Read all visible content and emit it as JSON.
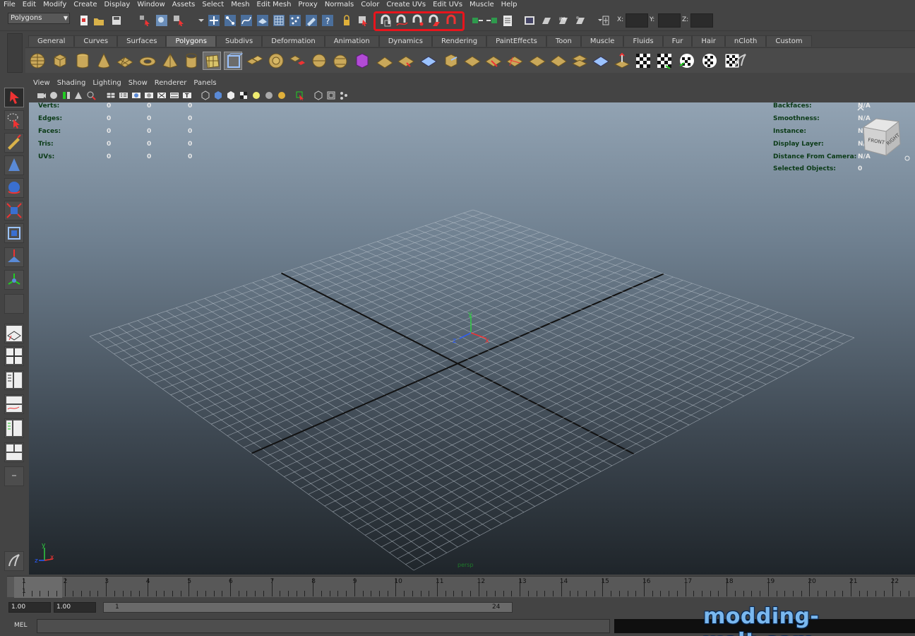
{
  "menubar": [
    "File",
    "Edit",
    "Modify",
    "Create",
    "Display",
    "Window",
    "Assets",
    "Select",
    "Mesh",
    "Edit Mesh",
    "Proxy",
    "Normals",
    "Color",
    "Create UVs",
    "Edit UVs",
    "Muscle",
    "Help"
  ],
  "statusline": {
    "mode": "Polygons",
    "x_label": "X:",
    "y_label": "Y:",
    "z_label": "Z:",
    "highlight_color": "#e8141c"
  },
  "shelf": {
    "tabs": [
      "General",
      "Curves",
      "Surfaces",
      "Polygons",
      "Subdivs",
      "Deformation",
      "Animation",
      "Dynamics",
      "Rendering",
      "PaintEffects",
      "Toon",
      "Muscle",
      "Fluids",
      "Fur",
      "Hair",
      "nCloth",
      "Custom"
    ],
    "active_tab": "Polygons"
  },
  "panel_menu": [
    "View",
    "Shading",
    "Lighting",
    "Show",
    "Renderer",
    "Panels"
  ],
  "hud_left": {
    "labels": [
      "Verts:",
      "Edges:",
      "Faces:",
      "Tris:",
      "UVs:"
    ],
    "values": [
      [
        "0",
        "0",
        "0"
      ],
      [
        "0",
        "0",
        "0"
      ],
      [
        "0",
        "0",
        "0"
      ],
      [
        "0",
        "0",
        "0"
      ],
      [
        "0",
        "0",
        "0"
      ]
    ]
  },
  "hud_right": {
    "labels": [
      "Backfaces:",
      "Smoothness:",
      "Instance:",
      "Display Layer:",
      "Distance From Camera:",
      "Selected Objects:"
    ],
    "values": [
      "N/A",
      "N/A",
      "N/A",
      "N/A",
      "N/A",
      "0"
    ]
  },
  "viewcube": {
    "front": "FRONT",
    "right": "RIGHT"
  },
  "axes": {
    "x": "x",
    "y": "y",
    "z": "z"
  },
  "camera_label": "persp",
  "timeline": {
    "current_frame": "1",
    "ticks": [
      "1",
      "2",
      "3",
      "4",
      "5",
      "6",
      "7",
      "8",
      "9",
      "10",
      "11",
      "12",
      "13",
      "14",
      "15",
      "16",
      "17",
      "18",
      "19",
      "20",
      "21",
      "22"
    ]
  },
  "range": {
    "start_time": "1.00",
    "playback_start": "1.00",
    "slider_start": "1",
    "slider_end": "24"
  },
  "cmdline": {
    "label": "MEL"
  },
  "watermark": "modding-welt.com"
}
